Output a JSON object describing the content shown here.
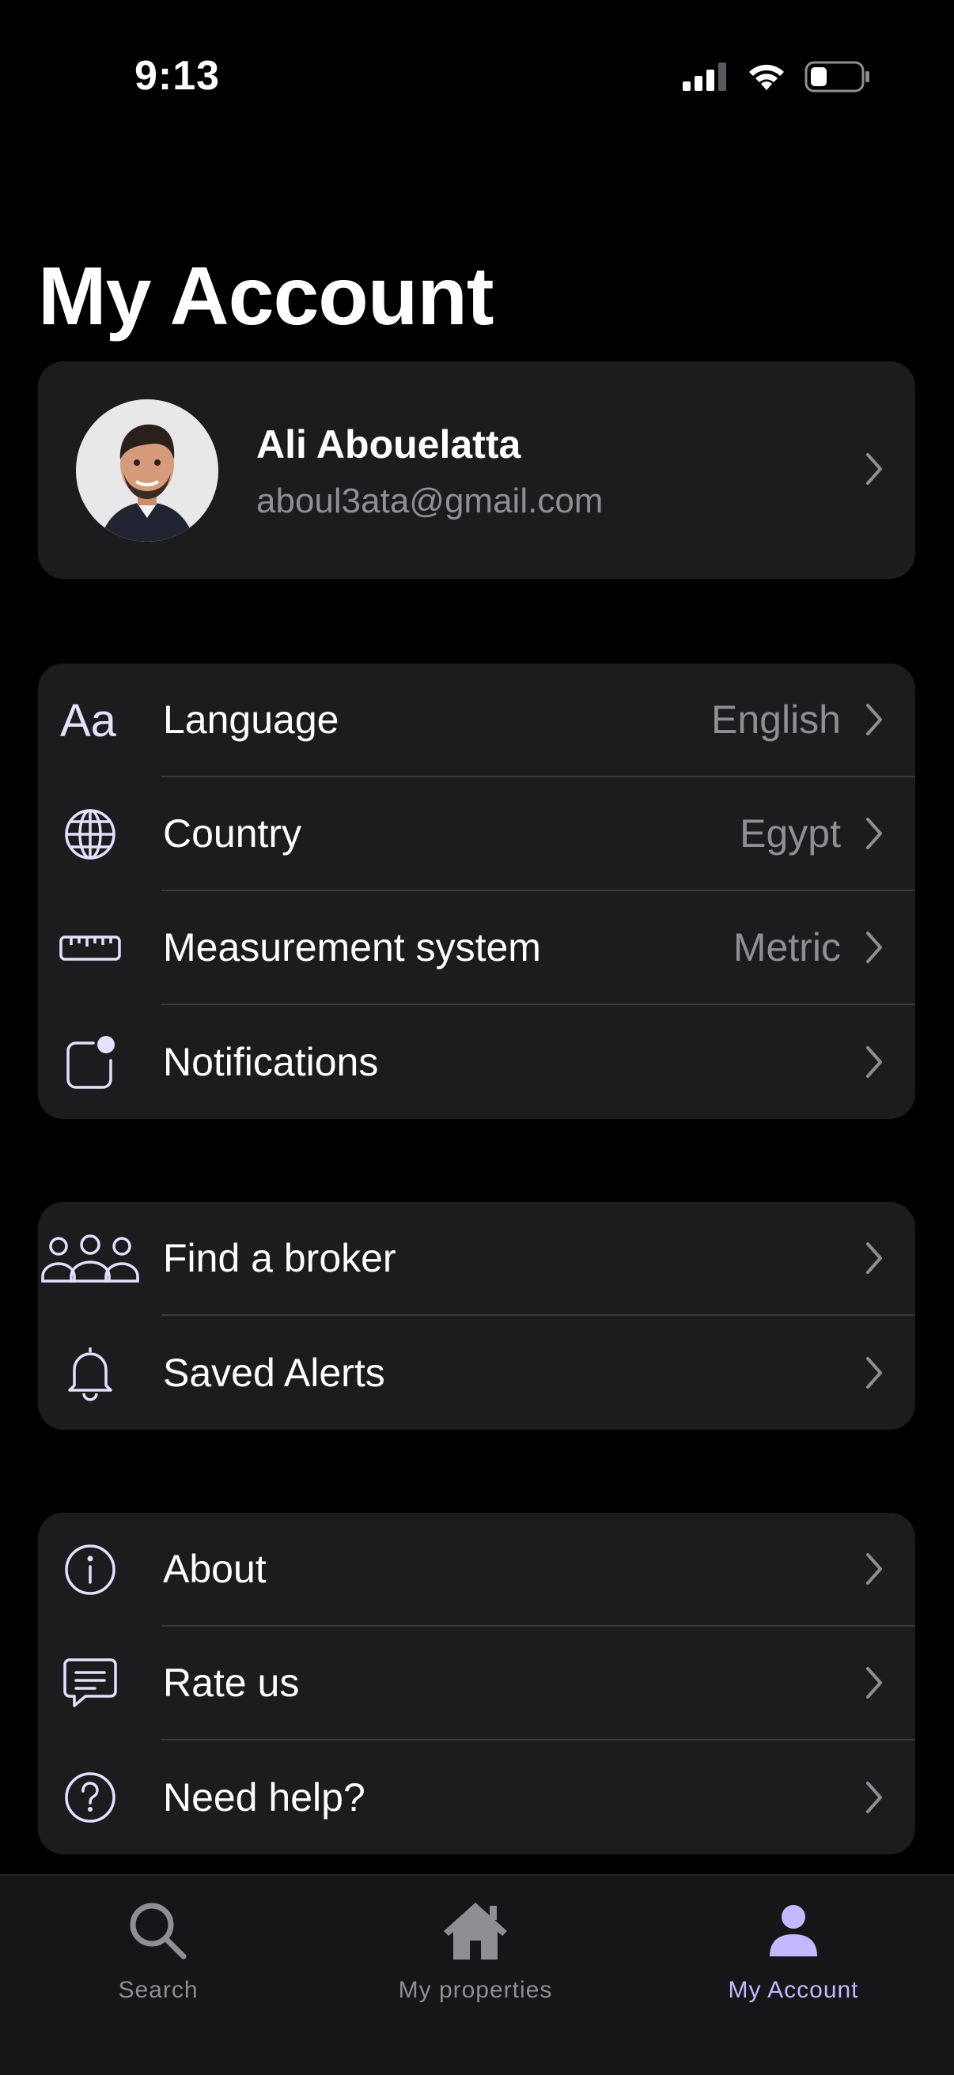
{
  "status_bar": {
    "time": "9:13"
  },
  "page": {
    "title": "My Account"
  },
  "profile": {
    "name": "Ali Abouelatta",
    "email": "aboul3ata@gmail.com"
  },
  "settings": {
    "items": [
      {
        "label": "Language",
        "value": "English",
        "icon": "text-size-icon"
      },
      {
        "label": "Country",
        "value": "Egypt",
        "icon": "globe-icon"
      },
      {
        "label": "Measurement system",
        "value": "Metric",
        "icon": "ruler-icon"
      },
      {
        "label": "Notifications",
        "value": "",
        "icon": "notification-badge-icon"
      }
    ]
  },
  "services": {
    "items": [
      {
        "label": "Find a broker",
        "icon": "people-icon"
      },
      {
        "label": "Saved Alerts",
        "icon": "bell-icon"
      }
    ]
  },
  "info": {
    "items": [
      {
        "label": "About",
        "icon": "info-icon"
      },
      {
        "label": "Rate us",
        "icon": "chat-icon"
      },
      {
        "label": "Need help?",
        "icon": "help-icon"
      }
    ]
  },
  "tabs": [
    {
      "label": "Search",
      "icon": "search-icon",
      "active": false
    },
    {
      "label": "My properties",
      "icon": "home-icon",
      "active": false
    },
    {
      "label": "My Account",
      "icon": "person-icon",
      "active": true
    }
  ],
  "colors": {
    "background": "#000000",
    "card": "#1c1c1e",
    "secondary_text": "#8e8e93",
    "icon_stroke": "#e6e0ff",
    "accent": "#c5b8ff"
  }
}
